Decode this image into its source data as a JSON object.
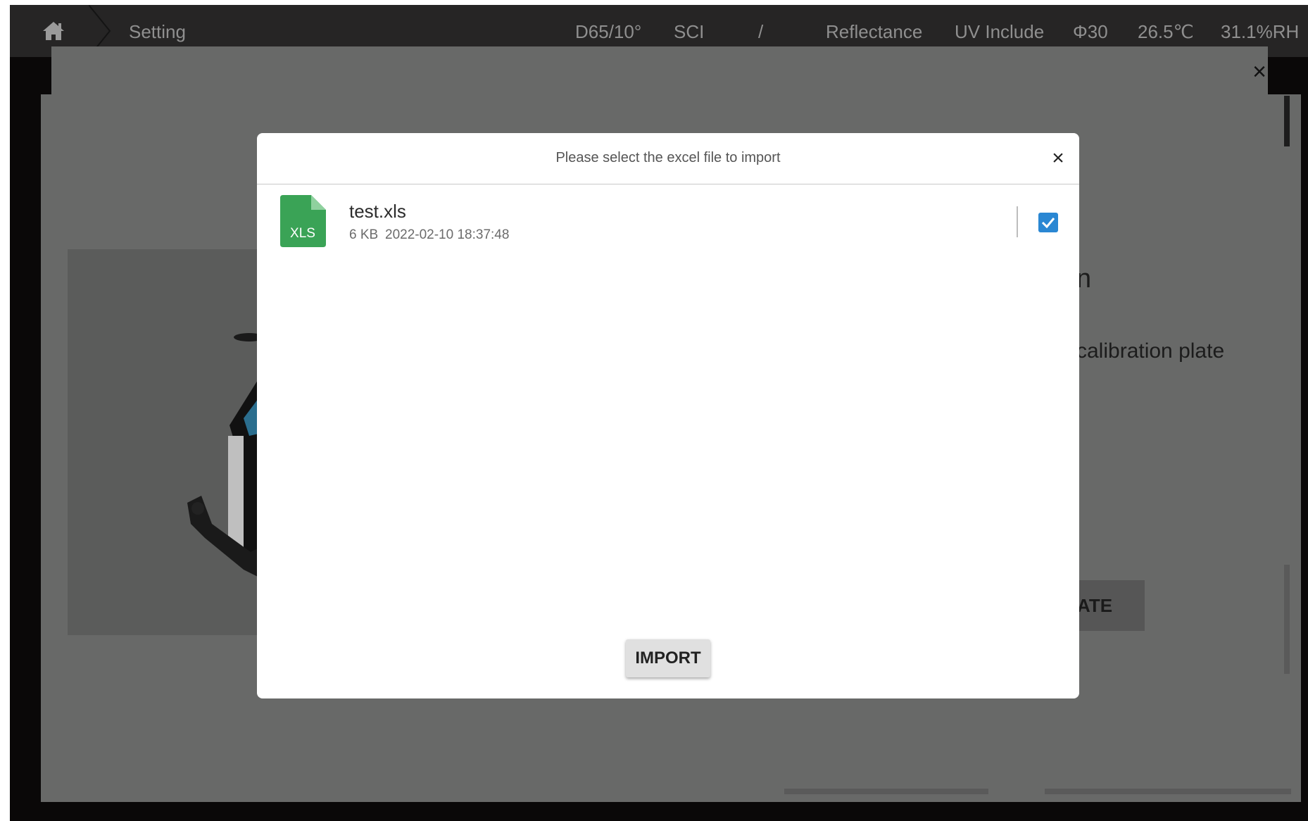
{
  "topbar": {
    "title": "Setting",
    "illuminant": "D65/10°",
    "mode": "SCI",
    "separator": "/",
    "measurement": "Reflectance",
    "uv": "UV Include",
    "aperture": "Φ30",
    "temperature": "26.5℃",
    "humidity": "31.1%RH"
  },
  "background": {
    "heading_fragment": "n",
    "description_fragment": "calibration plate",
    "button_fragment": "ATE",
    "close_label": "×"
  },
  "dialog": {
    "title": "Please select the excel file to import",
    "close_label": "×",
    "files": [
      {
        "icon_label": "XLS",
        "name": "test.xls",
        "size": "6 KB",
        "date": "2022-02-10 18:37:48",
        "checked": true
      }
    ],
    "import_label": "IMPORT"
  },
  "colors": {
    "accent": "#2a87d3",
    "file_icon": "#3aa356",
    "topbar": "#262525",
    "overlay": "#686968"
  },
  "icons": {
    "home": "home-icon",
    "close": "close-icon",
    "file": "xls-file-icon",
    "check": "checkbox-checked-icon"
  }
}
